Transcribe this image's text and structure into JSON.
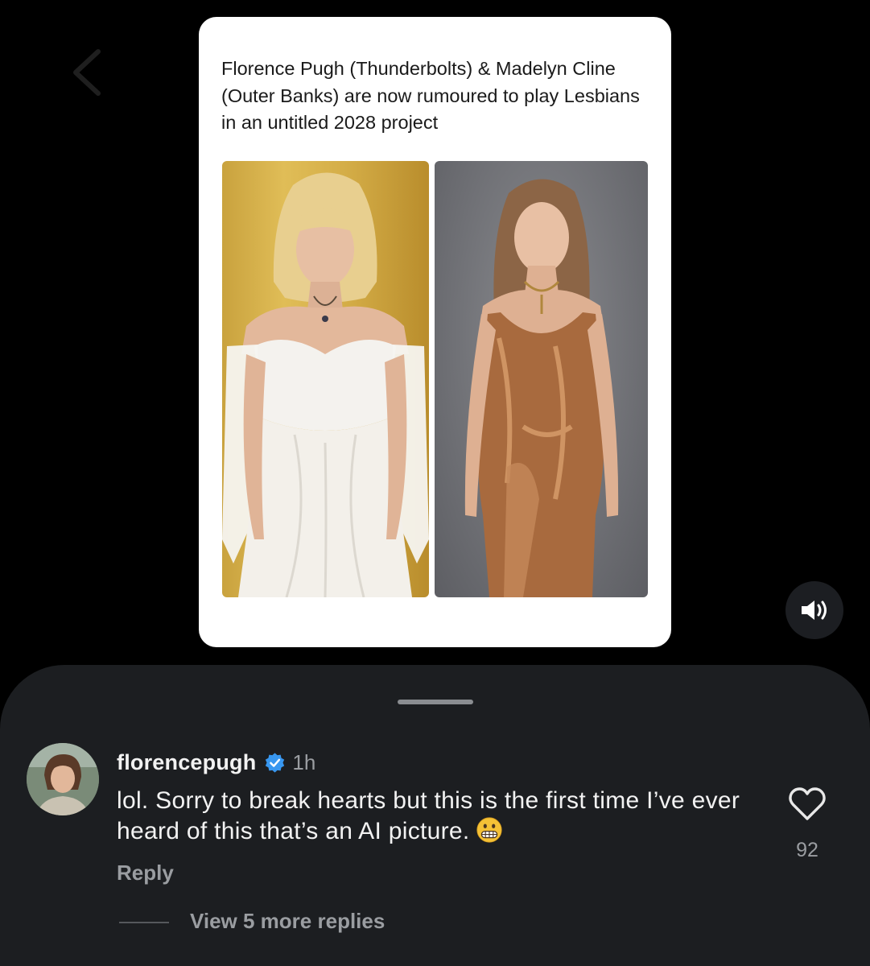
{
  "post": {
    "text": "Florence Pugh (Thunderbolts) & Madelyn Cline (Outer Banks) are now rumoured to play Lesbians in an untitled 2028 project"
  },
  "comment": {
    "username": "florencepugh",
    "verified_icon": "verified-badge-icon",
    "time": "1h",
    "text": "lol. Sorry to break hearts but this is the first time I’ve ever heard of this that’s an AI picture.",
    "emoji": "grimacing-face-emoji",
    "reply_label": "Reply",
    "like_count": "92",
    "view_replies_label": "View 5 more replies"
  },
  "colors": {
    "background": "#000000",
    "sheet": "#1c1e21",
    "verified": "#3897f0",
    "muted_text": "#9a9da1"
  }
}
